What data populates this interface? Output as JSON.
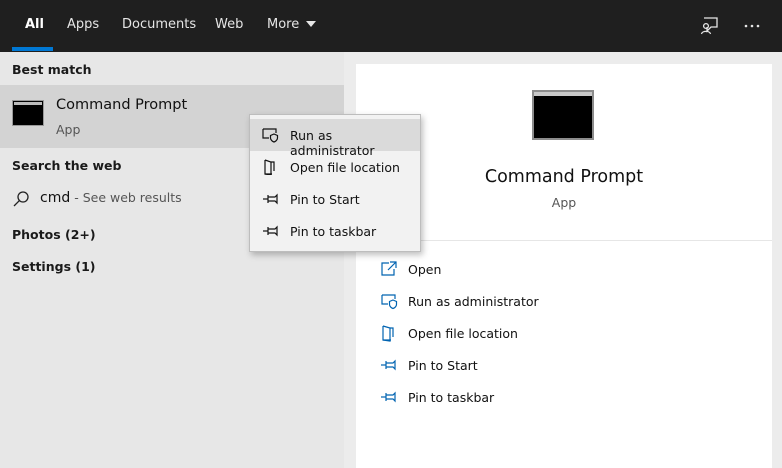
{
  "tabs": [
    {
      "label": "All",
      "active": true
    },
    {
      "label": "Apps"
    },
    {
      "label": "Documents"
    },
    {
      "label": "Web"
    },
    {
      "label": "More"
    }
  ],
  "top_icons": {
    "feedback": "feedback-icon",
    "more": "ellipsis-icon",
    "more_glyph": "···"
  },
  "left": {
    "best_match_heading": "Best match",
    "best_match": {
      "title": "Command Prompt",
      "subtitle": "App",
      "icon": "command-prompt-icon"
    },
    "search_web_heading": "Search the web",
    "search": {
      "term": "cmd",
      "suffix": " - See web results",
      "icon": "search-icon"
    },
    "photos": "Photos (2+)",
    "settings": "Settings (1)"
  },
  "context_menu": [
    {
      "label": "Run as administrator",
      "icon": "shield-icon",
      "highlighted": true
    },
    {
      "label": "Open file location",
      "icon": "folder-icon"
    },
    {
      "label": "Pin to Start",
      "icon": "pin-icon"
    },
    {
      "label": "Pin to taskbar",
      "icon": "pin-icon"
    }
  ],
  "detail": {
    "title": "Command Prompt",
    "subtitle": "App",
    "actions": [
      {
        "label": "Open",
        "icon": "open-icon"
      },
      {
        "label": "Run as administrator",
        "icon": "shield-icon"
      },
      {
        "label": "Open file location",
        "icon": "folder-icon"
      },
      {
        "label": "Pin to Start",
        "icon": "pin-icon"
      },
      {
        "label": "Pin to taskbar",
        "icon": "pin-icon"
      }
    ]
  },
  "colors": {
    "topbar": "#1f1f1f",
    "accent": "#0078d4",
    "left_bg": "#e7e7e7",
    "selected_row": "#d3d3d3",
    "card": "#ffffff"
  }
}
